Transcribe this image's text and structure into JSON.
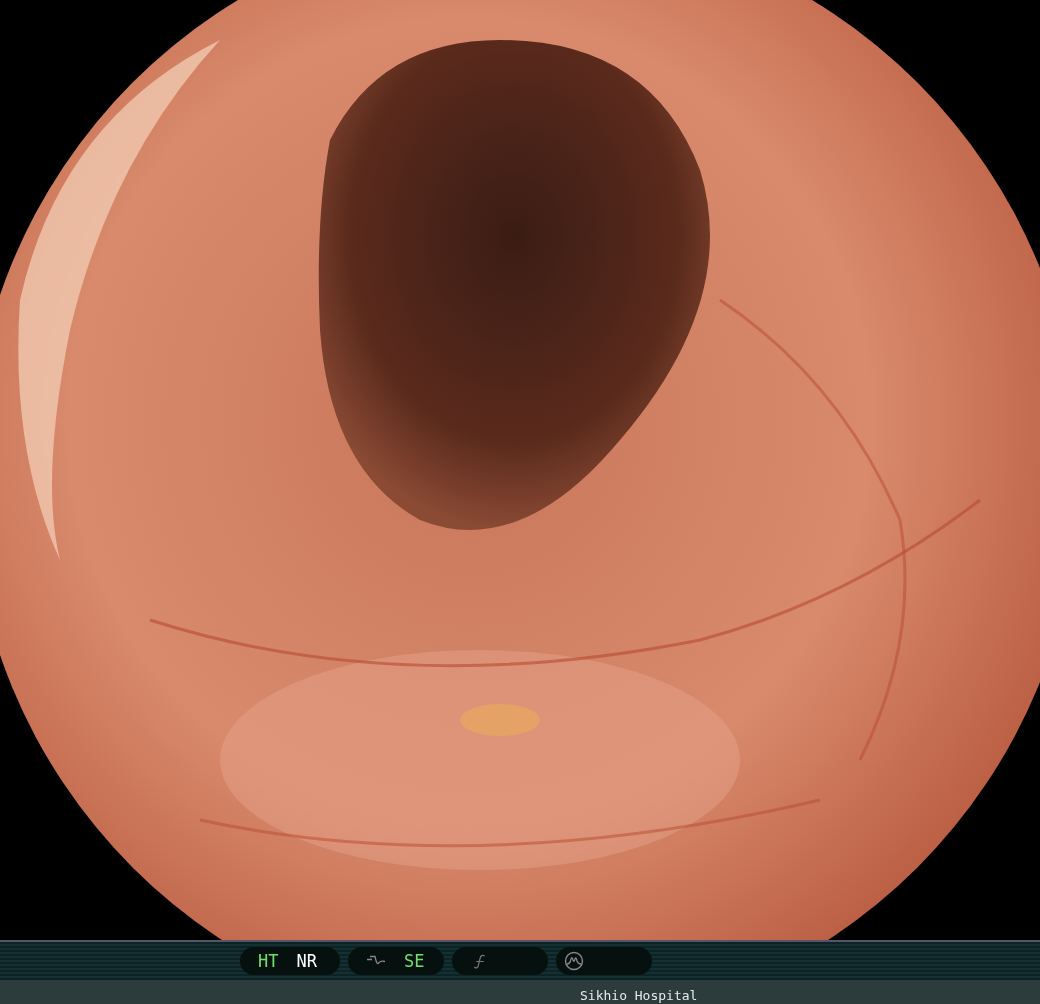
{
  "indicators": [
    {
      "label": "HT",
      "active": true
    },
    {
      "label": "NR",
      "active": false
    },
    {
      "label": "SE",
      "active": true
    }
  ],
  "status_bar": {
    "hospital": "Sikhio Hospital"
  }
}
